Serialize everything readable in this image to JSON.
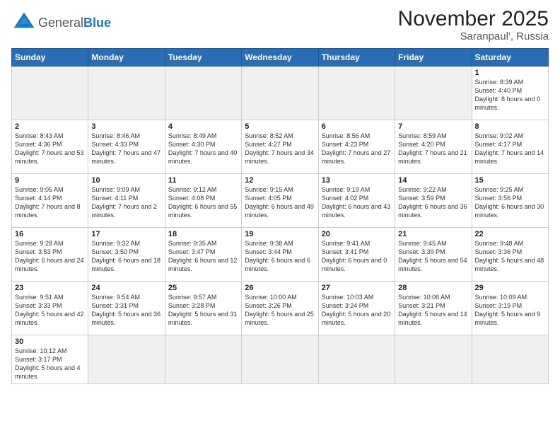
{
  "header": {
    "logo_general": "General",
    "logo_blue": "Blue",
    "month_title": "November 2025",
    "location": "Saranpaul', Russia"
  },
  "days_of_week": [
    "Sunday",
    "Monday",
    "Tuesday",
    "Wednesday",
    "Thursday",
    "Friday",
    "Saturday"
  ],
  "weeks": [
    [
      {
        "day": "",
        "info": "",
        "empty": true
      },
      {
        "day": "",
        "info": "",
        "empty": true
      },
      {
        "day": "",
        "info": "",
        "empty": true
      },
      {
        "day": "",
        "info": "",
        "empty": true
      },
      {
        "day": "",
        "info": "",
        "empty": true
      },
      {
        "day": "",
        "info": "",
        "empty": true
      },
      {
        "day": "1",
        "info": "Sunrise: 8:39 AM\nSunset: 4:40 PM\nDaylight: 8 hours\nand 0 minutes."
      }
    ],
    [
      {
        "day": "2",
        "info": "Sunrise: 8:43 AM\nSunset: 4:36 PM\nDaylight: 7 hours\nand 53 minutes."
      },
      {
        "day": "3",
        "info": "Sunrise: 8:46 AM\nSunset: 4:33 PM\nDaylight: 7 hours\nand 47 minutes."
      },
      {
        "day": "4",
        "info": "Sunrise: 8:49 AM\nSunset: 4:30 PM\nDaylight: 7 hours\nand 40 minutes."
      },
      {
        "day": "5",
        "info": "Sunrise: 8:52 AM\nSunset: 4:27 PM\nDaylight: 7 hours\nand 34 minutes."
      },
      {
        "day": "6",
        "info": "Sunrise: 8:56 AM\nSunset: 4:23 PM\nDaylight: 7 hours\nand 27 minutes."
      },
      {
        "day": "7",
        "info": "Sunrise: 8:59 AM\nSunset: 4:20 PM\nDaylight: 7 hours\nand 21 minutes."
      },
      {
        "day": "8",
        "info": "Sunrise: 9:02 AM\nSunset: 4:17 PM\nDaylight: 7 hours\nand 14 minutes."
      }
    ],
    [
      {
        "day": "9",
        "info": "Sunrise: 9:05 AM\nSunset: 4:14 PM\nDaylight: 7 hours\nand 8 minutes."
      },
      {
        "day": "10",
        "info": "Sunrise: 9:09 AM\nSunset: 4:11 PM\nDaylight: 7 hours\nand 2 minutes."
      },
      {
        "day": "11",
        "info": "Sunrise: 9:12 AM\nSunset: 4:08 PM\nDaylight: 6 hours\nand 55 minutes."
      },
      {
        "day": "12",
        "info": "Sunrise: 9:15 AM\nSunset: 4:05 PM\nDaylight: 6 hours\nand 49 minutes."
      },
      {
        "day": "13",
        "info": "Sunrise: 9:19 AM\nSunset: 4:02 PM\nDaylight: 6 hours\nand 43 minutes."
      },
      {
        "day": "14",
        "info": "Sunrise: 9:22 AM\nSunset: 3:59 PM\nDaylight: 6 hours\nand 36 minutes."
      },
      {
        "day": "15",
        "info": "Sunrise: 9:25 AM\nSunset: 3:56 PM\nDaylight: 6 hours\nand 30 minutes."
      }
    ],
    [
      {
        "day": "16",
        "info": "Sunrise: 9:28 AM\nSunset: 3:53 PM\nDaylight: 6 hours\nand 24 minutes."
      },
      {
        "day": "17",
        "info": "Sunrise: 9:32 AM\nSunset: 3:50 PM\nDaylight: 6 hours\nand 18 minutes."
      },
      {
        "day": "18",
        "info": "Sunrise: 9:35 AM\nSunset: 3:47 PM\nDaylight: 6 hours\nand 12 minutes."
      },
      {
        "day": "19",
        "info": "Sunrise: 9:38 AM\nSunset: 3:44 PM\nDaylight: 6 hours\nand 6 minutes."
      },
      {
        "day": "20",
        "info": "Sunrise: 9:41 AM\nSunset: 3:41 PM\nDaylight: 6 hours\nand 0 minutes."
      },
      {
        "day": "21",
        "info": "Sunrise: 9:45 AM\nSunset: 3:39 PM\nDaylight: 5 hours\nand 54 minutes."
      },
      {
        "day": "22",
        "info": "Sunrise: 9:48 AM\nSunset: 3:36 PM\nDaylight: 5 hours\nand 48 minutes."
      }
    ],
    [
      {
        "day": "23",
        "info": "Sunrise: 9:51 AM\nSunset: 3:33 PM\nDaylight: 5 hours\nand 42 minutes."
      },
      {
        "day": "24",
        "info": "Sunrise: 9:54 AM\nSunset: 3:31 PM\nDaylight: 5 hours\nand 36 minutes."
      },
      {
        "day": "25",
        "info": "Sunrise: 9:57 AM\nSunset: 3:28 PM\nDaylight: 5 hours\nand 31 minutes."
      },
      {
        "day": "26",
        "info": "Sunrise: 10:00 AM\nSunset: 3:26 PM\nDaylight: 5 hours\nand 25 minutes."
      },
      {
        "day": "27",
        "info": "Sunrise: 10:03 AM\nSunset: 3:24 PM\nDaylight: 5 hours\nand 20 minutes."
      },
      {
        "day": "28",
        "info": "Sunrise: 10:06 AM\nSunset: 3:21 PM\nDaylight: 5 hours\nand 14 minutes."
      },
      {
        "day": "29",
        "info": "Sunrise: 10:09 AM\nSunset: 3:19 PM\nDaylight: 5 hours\nand 9 minutes."
      }
    ],
    [
      {
        "day": "30",
        "info": "Sunrise: 10:12 AM\nSunset: 3:17 PM\nDaylight: 5 hours\nand 4 minutes.",
        "last": true
      },
      {
        "day": "",
        "info": "",
        "empty": true,
        "last": true
      },
      {
        "day": "",
        "info": "",
        "empty": true,
        "last": true
      },
      {
        "day": "",
        "info": "",
        "empty": true,
        "last": true
      },
      {
        "day": "",
        "info": "",
        "empty": true,
        "last": true
      },
      {
        "day": "",
        "info": "",
        "empty": true,
        "last": true
      },
      {
        "day": "",
        "info": "",
        "empty": true,
        "last": true
      }
    ]
  ]
}
